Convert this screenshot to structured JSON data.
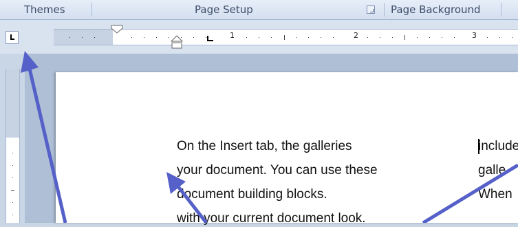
{
  "ribbon": {
    "groups": [
      "Themes",
      "Page Setup",
      "Page Background"
    ]
  },
  "ruler": {
    "numbers": [
      "1",
      "2",
      "3"
    ]
  },
  "document": {
    "column1": [
      "On the Insert tab, the galleries",
      "your document. You can use these",
      "document building blocks.",
      "with your current document look."
    ],
    "column2": [
      "include",
      "galle",
      "When"
    ]
  },
  "annotation": {
    "arrow_color": "#5560c8"
  }
}
